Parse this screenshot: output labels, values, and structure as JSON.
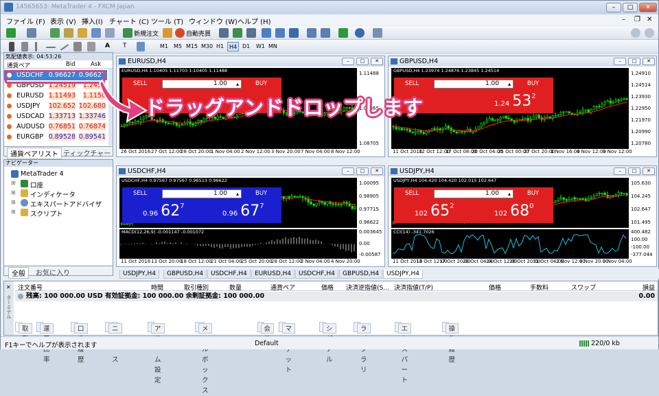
{
  "window": {
    "title": "14565653: MetaTrader 4 - FXCM Japan"
  },
  "menu": [
    "ファイル (F)",
    "表示 (V)",
    "挿入(I)",
    "チャート (C)",
    "ツール (T)",
    "ウィンドウ (W)",
    "ヘルプ (H)"
  ],
  "toolbar": {
    "new_order": "新規注文",
    "auto_trade": "自動売買"
  },
  "timeframes": [
    "M1",
    "M5",
    "M15",
    "M30",
    "H1",
    "H4",
    "D1",
    "W1",
    "MN"
  ],
  "market_watch": {
    "header": "気配値表示: 04:53:26",
    "col_symbol": "通貨ペア",
    "col_bid": "Bid",
    "col_ask": "Ask",
    "rows": [
      {
        "symbol": "USDCHF",
        "bid": "0.96627",
        "ask": "0.96627"
      },
      {
        "symbol": "GBPUSD",
        "bid": "1.24519",
        "ask": "1.2451"
      },
      {
        "symbol": "EURUSD",
        "bid": "1.11493",
        "ask": "1.1150"
      },
      {
        "symbol": "USDJPY",
        "bid": "102.652",
        "ask": "102.680"
      },
      {
        "symbol": "USDCAD",
        "bid": "1.33713",
        "ask": "1.33746"
      },
      {
        "symbol": "AUDUSD",
        "bid": "0.76851",
        "ask": "0.76874"
      },
      {
        "symbol": "EURGBP",
        "bid": "0.89528",
        "ask": "0.89541"
      }
    ],
    "tabs": [
      "通貨ペアリスト",
      "ティックチャート"
    ]
  },
  "navigator": {
    "header": "ナビゲーター",
    "root": "MetaTrader 4",
    "items": [
      "口座",
      "インディケータ",
      "エキスパートアドバイザ",
      "スクリプト"
    ],
    "tabs": [
      "全般",
      "お気に入り"
    ]
  },
  "charts": [
    {
      "title": "EURUSD,H4",
      "ohlc": "EURUSD,H4  1.10405 1.11703 1.10405 1.11488",
      "lot": "1.00",
      "sell_label": "SELL",
      "buy_label": "BUY",
      "y": [
        "1.11488",
        "1.09365",
        "1.08705"
      ],
      "x": [
        "26 Oct 2016",
        "27 Oct 12:00",
        "28 Oct 20:00",
        "1 Nov 04:00",
        "2 Nov 12:00",
        "3 Nov 20:00",
        "7 Nov 04:00",
        "8 Nov 12:00"
      ]
    },
    {
      "title": "GBPUSD,H4",
      "ohlc": "GBPUSD,H4  1.23974 1.24876 1.23845 1.24514",
      "lot": "1.00",
      "sell_label": "SELL",
      "buy_label": "BUY",
      "buy_price_small": "1.24",
      "buy_price_big": "53",
      "buy_price_sup": "2",
      "y": [
        "1.24910",
        "1.24514",
        "1.23930",
        "1.22950",
        "1.21970",
        "1.20990",
        "1.20780"
      ],
      "x": [
        "11 Oct 2016",
        "12 Oct 12:00",
        "17 Oct 08:00",
        "20 Oct 04:00",
        "25 Oct 00:00",
        "27 Oct 20:00",
        "1 Nov 16:00",
        "4 Nov 12:00",
        "9 Nov 12:00"
      ]
    },
    {
      "title": "USDCHF,H4",
      "ohlc": "USDCHF,H4  0.97567 0.97567 0.96513 0.96622",
      "lot": "1.00",
      "sell_label": "SELL",
      "buy_label": "BUY",
      "sell_price_small": "0.96",
      "sell_price_big": "62",
      "sell_price_sup": "7",
      "buy_price_small": "0.96",
      "buy_price_big": "67",
      "buy_price_sup": "7",
      "y": [
        "1.00095",
        "0.98905",
        "0.97715",
        "0.96622"
      ],
      "macd_label": "MACD(12,26,9) -0.001147 -0.001072",
      "macd_y": [
        "0.003645",
        "0.00",
        "-0.00587"
      ],
      "x": [
        "11 Oct 2016",
        "13 Oct 20:00",
        "18 Oct 12:00",
        "21 Oct 04:00",
        "25 Oct 20:00",
        "28 Oct 12:00",
        "2 Nov 04:00",
        "4 Nov 20:00"
      ]
    },
    {
      "title": "USDJPY,H4",
      "ohlc": "USDJPY,H4  104.420 104.420 102.015 102.647",
      "lot": "1.00",
      "sell_label": "SELL",
      "buy_label": "BUY",
      "sell_price_small": "102",
      "sell_price_big": "65",
      "sell_price_sup": "2",
      "buy_price_small": "102",
      "buy_price_big": "68",
      "buy_price_sup": "0",
      "y": [
        "105.630",
        "104.245",
        "102.647",
        "101.495"
      ],
      "cci_label": "CCI(14) -341.7026",
      "cci_y": [
        "400.482",
        "100.00",
        "-100.00",
        "-377.044"
      ],
      "x": [
        "11 Oct 2016",
        "13 Oct 12:00",
        "17 Oct 20:00",
        "20 Oct 04:00",
        "24 Oct 12:00",
        "26 Oct 20:00",
        "31 Oct 04:00",
        "2 Nov 12:00",
        "4 Nov 20:00",
        "9 Nov 04:00"
      ]
    }
  ],
  "chart_tabs": [
    "USDJPY,H4",
    "GBPUSD,H4",
    "USDCHF,H4",
    "EURUSD,H4",
    "USDCHF,H4",
    "GBPUSD,H4",
    "USDJPY,H4"
  ],
  "terminal": {
    "columns": [
      "注文番号",
      "時間",
      "取引種別",
      "数量",
      "通貨ペア",
      "価格",
      "決済逆指値(S...",
      "決済指値(T/P)",
      "価格",
      "手数料",
      "スワップ",
      "損益"
    ],
    "balance_text": "残高: 100 000.00 USD  有効証拠金: 100 000.00  余剰証拠金: 100 000.00",
    "balance_value": "0.00",
    "side_label": "ターミナル",
    "tabs": [
      {
        "label": "取引"
      },
      {
        "label": "運用比率"
      },
      {
        "label": "口座履歴"
      },
      {
        "label": "ニュース",
        "badge": "99"
      },
      {
        "label": "アラーム設定"
      },
      {
        "label": "メールボックス",
        "badge": "8"
      },
      {
        "label": "会社"
      },
      {
        "label": "マーケット"
      },
      {
        "label": "シグナル"
      },
      {
        "label": "ライブラリ"
      },
      {
        "label": "エキスパート"
      },
      {
        "label": "操作履歴"
      }
    ]
  },
  "status": {
    "help": "F1キーでヘルプが表示されます",
    "profile": "Default",
    "traffic": "220/0 kb"
  },
  "overlay": {
    "text": "ドラッグアンドドロップします"
  },
  "colors": {
    "sell_red": "#e02020",
    "buy_blue": "#1a1fd0",
    "highlight": "#e0407e"
  }
}
